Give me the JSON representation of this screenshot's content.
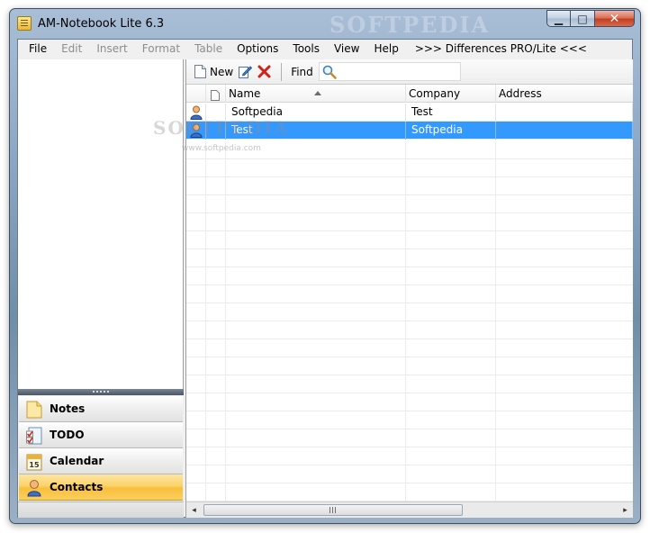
{
  "window": {
    "title": "AM-Notebook Lite  6.3",
    "watermark": "SOFTPEDIA",
    "caption_buttons": {
      "minimize": "▁",
      "maximize": "□",
      "close": "✕"
    }
  },
  "menubar": {
    "items": [
      {
        "label": "File",
        "enabled": true
      },
      {
        "label": "Edit",
        "enabled": false
      },
      {
        "label": "Insert",
        "enabled": false
      },
      {
        "label": "Format",
        "enabled": false
      },
      {
        "label": "Table",
        "enabled": false
      },
      {
        "label": "Options",
        "enabled": true
      },
      {
        "label": "Tools",
        "enabled": true
      },
      {
        "label": "View",
        "enabled": true
      },
      {
        "label": "Help",
        "enabled": true
      }
    ],
    "promo": ">>> Differences PRO/Lite <<<"
  },
  "toolbar": {
    "new_label": "New",
    "find_label": "Find",
    "find_value": ""
  },
  "navigation": {
    "items": [
      {
        "label": "Notes",
        "icon": "note-icon",
        "active": false
      },
      {
        "label": "TODO",
        "icon": "todo-checklist-icon",
        "active": false
      },
      {
        "label": "Calendar",
        "icon": "calendar-icon",
        "active": false,
        "calendar_day": "15"
      },
      {
        "label": "Contacts",
        "icon": "contact-person-icon",
        "active": true
      }
    ]
  },
  "grid": {
    "columns": [
      "Name",
      "Company",
      "Address"
    ],
    "sorted_column": "Name",
    "sort_direction": "ascending",
    "rows": [
      {
        "name": "Softpedia",
        "company": "Test",
        "address": "",
        "selected": false
      },
      {
        "name": "Test",
        "company": "Softpedia",
        "address": "",
        "selected": true
      }
    ]
  },
  "overlay": {
    "watermark": "SOFTPEDIA",
    "watermark_url": "www.softpedia.com"
  },
  "scrollbar": {
    "left_arrow": "◂",
    "right_arrow": "▸"
  },
  "colors": {
    "selection": "#3399ff",
    "active_nav": "#fbd26a",
    "delete_red": "#d0201a"
  }
}
